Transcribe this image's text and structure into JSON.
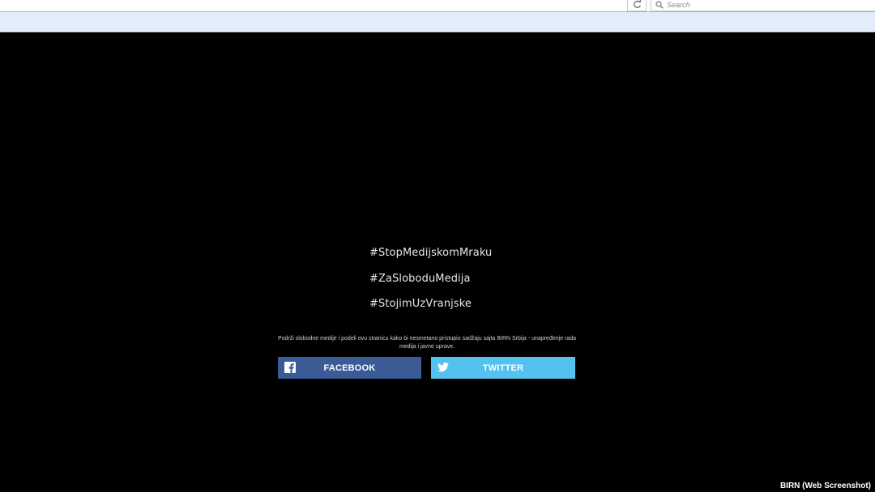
{
  "browser": {
    "search_placeholder": "Search"
  },
  "page": {
    "hashtags": [
      "#StopMedijskomMraku",
      "#ZaSloboduMedija",
      "#StojimUzVranjske"
    ],
    "support_text": "Podrži slobodne medije i podeli ovu stranicu kako bi nesmetano pristupio sadžaju sajta BIRN Srbija - unapređenje rada medija i javne uprave.",
    "facebook_label": "FACEBOOK",
    "twitter_label": "TWITTER",
    "facebook_color": "#3b5b96",
    "twitter_color": "#55c1ee",
    "facebook_icon": "facebook-icon",
    "twitter_icon": "twitter-icon"
  },
  "credit": "BIRN (Web Screenshot)"
}
